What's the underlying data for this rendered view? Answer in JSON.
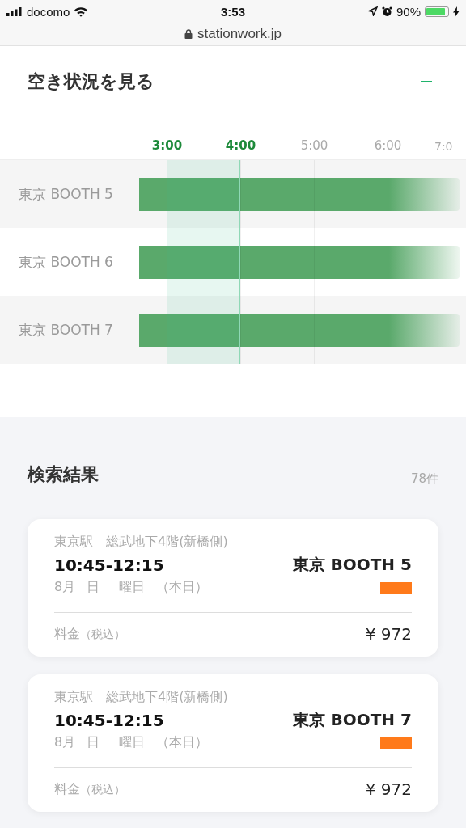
{
  "status_bar": {
    "carrier": "docomo",
    "time": "3:53",
    "battery": "90%"
  },
  "url_bar": {
    "url": "stationwork.jp"
  },
  "availability": {
    "title": "空き状況を見る",
    "expanded": true,
    "times": [
      {
        "label": "3:00",
        "selected": true
      },
      {
        "label": "4:00",
        "selected": true
      },
      {
        "label": "5:00",
        "selected": false
      },
      {
        "label": "6:00",
        "selected": false
      },
      {
        "label": "7:0",
        "selected": false
      }
    ],
    "booths": [
      {
        "name": "東京 BOOTH 5"
      },
      {
        "name": "東京 BOOTH 6"
      },
      {
        "name": "東京 BOOTH 7"
      }
    ]
  },
  "results": {
    "title": "検索結果",
    "count": "78件",
    "cards": [
      {
        "station": "東京駅",
        "location": "総武地下4階(新橋側)",
        "time": "10:45-12:15",
        "month": "8月",
        "day": "日",
        "weekday": "曜日",
        "today": "（本日）",
        "booth": "東京 BOOTH 5",
        "color": "#ff7a1a",
        "price_label": "料金",
        "tax_note": "（税込）",
        "price": "¥ 972"
      },
      {
        "station": "東京駅",
        "location": "総武地下4階(新橋側)",
        "time": "10:45-12:15",
        "month": "8月",
        "day": "日",
        "weekday": "曜日",
        "today": "（本日）",
        "booth": "東京 BOOTH 7",
        "color": "#ff7a1a",
        "price_label": "料金",
        "tax_note": "（税込）",
        "price": "¥ 972"
      }
    ]
  }
}
